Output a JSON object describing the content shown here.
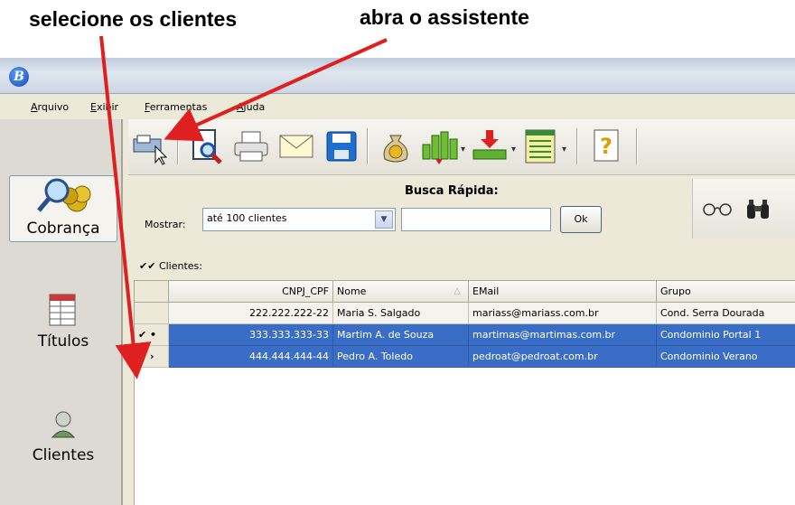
{
  "annotations": {
    "left_text": "selecione os clientes",
    "right_text": "abra o assistente",
    "arrow_color": "#e02020"
  },
  "window": {
    "logo_letter": "B",
    "menu": [
      "Arquivo",
      "Exibir",
      "Ferramentas",
      "Ajuda"
    ]
  },
  "sidebar": {
    "items": [
      {
        "label": "Cobrança",
        "icon": "magnifier-coins-icon",
        "active": true
      },
      {
        "label": "Títulos",
        "icon": "table-doc-icon"
      },
      {
        "label": "Clientes",
        "icon": "person-icon"
      }
    ]
  },
  "toolbar": {
    "buttons": [
      "wizard-icon",
      "print-preview-icon",
      "printer-icon",
      "envelope-icon",
      "save-disk-icon",
      "money-bag-icon",
      "green-chart-icon",
      "download-tray-icon",
      "list-icon",
      "help-icon"
    ]
  },
  "search": {
    "title": "Busca Rápida:",
    "show_label": "Mostrar:",
    "show_value": "até 100 clientes",
    "input_value": "",
    "ok_label": "Ok",
    "right_icons": [
      "glasses-icon",
      "binoculars-icon"
    ]
  },
  "clients_label": "Clientes:",
  "table": {
    "headers": [
      "",
      "CNPJ_CPF",
      "Nome",
      "EMail",
      "Grupo"
    ],
    "rows": [
      {
        "marker": "",
        "cnpj": "222.222.222-22",
        "nome": "Maria S. Salgado",
        "email": "mariass@mariass.com.br",
        "grupo": "Cond. Serra Dourada",
        "selected": false
      },
      {
        "marker": "✔ •",
        "cnpj": "333.333.333-33",
        "nome": "Martim A. de Souza",
        "email": "martimas@martimas.com.br",
        "grupo": "Condominio Portal 1",
        "selected": true
      },
      {
        "marker": "✔ ›",
        "cnpj": "444.444.444-44",
        "nome": "Pedro A. Toledo",
        "email": "pedroat@pedroat.com.br",
        "grupo": "Condominio Verano",
        "selected": true
      }
    ]
  }
}
